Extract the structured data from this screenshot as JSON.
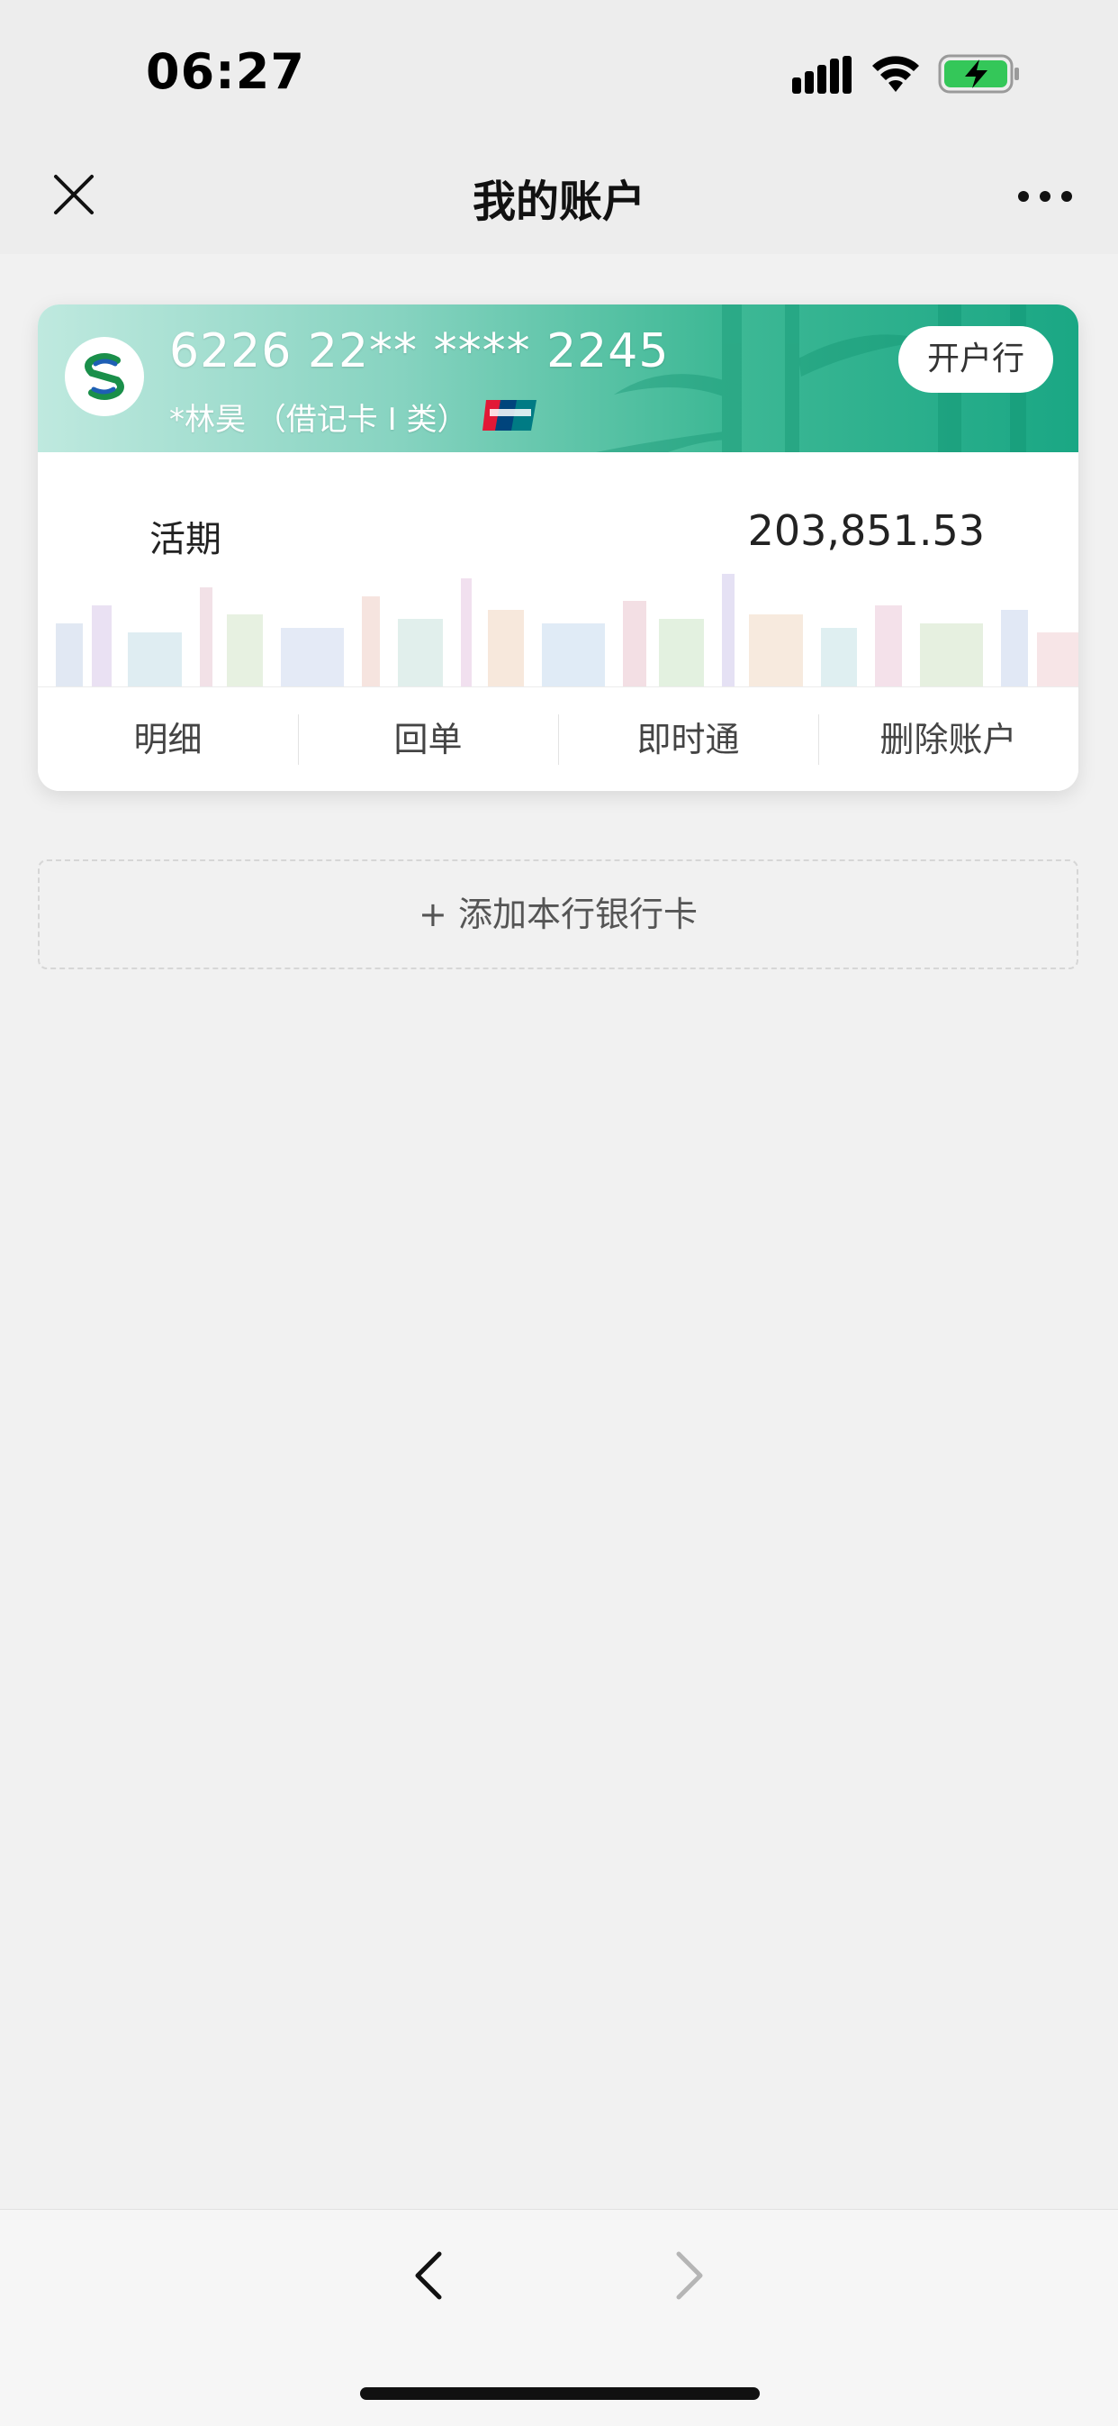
{
  "status_bar": {
    "time": "06:27",
    "icons": [
      "signal-icon",
      "wifi-icon",
      "battery-charging-icon"
    ]
  },
  "header": {
    "title": "我的账户",
    "left_icon": "close-icon",
    "right_icon": "more-icon"
  },
  "card": {
    "bank_logo": "bank-logo-icon",
    "card_number": "6226 22** **** 2245",
    "holder_info": "*林昊 （借记卡 I 类）",
    "network_icon": "unionpay-icon",
    "open_bank_label": "开户行",
    "account_type": "活期",
    "balance": "203,851.53",
    "actions": [
      {
        "label": "明细"
      },
      {
        "label": "回单"
      },
      {
        "label": "即时通"
      },
      {
        "label": "删除账户"
      }
    ]
  },
  "add_card": {
    "label": "+ 添加本行银行卡"
  },
  "toolbar": {
    "back_icon": "chevron-left-icon",
    "forward_icon": "chevron-right-icon"
  },
  "colors": {
    "card_header_start": "#bfe9df",
    "card_header_end": "#1aa784",
    "background": "#f1f1f1"
  }
}
